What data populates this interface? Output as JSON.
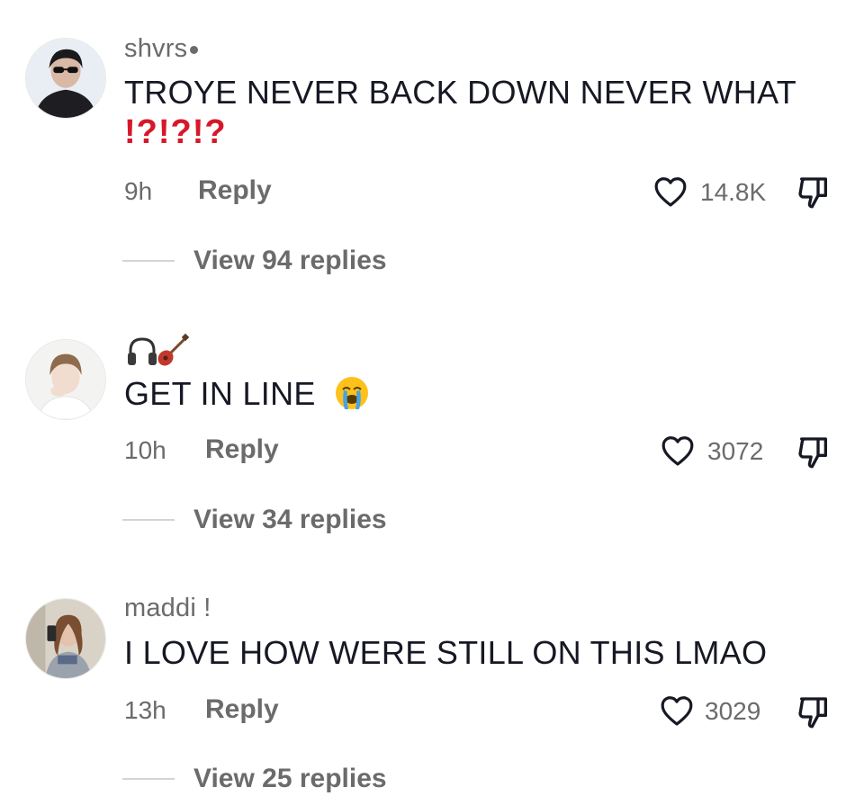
{
  "comments": [
    {
      "username": "shvrs",
      "text": "TROYE NEVER BACK DOWN NEVER WHAT",
      "text_suffix": "⁉️⁉️⁉️",
      "time": "9h",
      "reply_label": "Reply",
      "likes": "14.8K",
      "view_replies": "View 94 replies",
      "avatar_icon": "avatar-sunglasses-person"
    },
    {
      "username_icons": [
        "headphones-icon",
        "guitar-icon"
      ],
      "text": "GET IN LINE",
      "text_emoji": "loudly-crying-face",
      "time": "10h",
      "reply_label": "Reply",
      "likes": "3072",
      "view_replies": "View 34 replies",
      "avatar_icon": "avatar-person-hand-on-cheek"
    },
    {
      "username": "maddi !",
      "text": "I LOVE HOW WERE STILL ON THIS LMAO",
      "time": "13h",
      "reply_label": "Reply",
      "likes": "3029",
      "view_replies": "View 25 replies",
      "avatar_icon": "avatar-mirror-selfie"
    }
  ],
  "colors": {
    "text_primary": "#161823",
    "text_secondary": "#6b6b6b",
    "accent_red": "#d7182a",
    "divider": "#d4d4d4"
  }
}
